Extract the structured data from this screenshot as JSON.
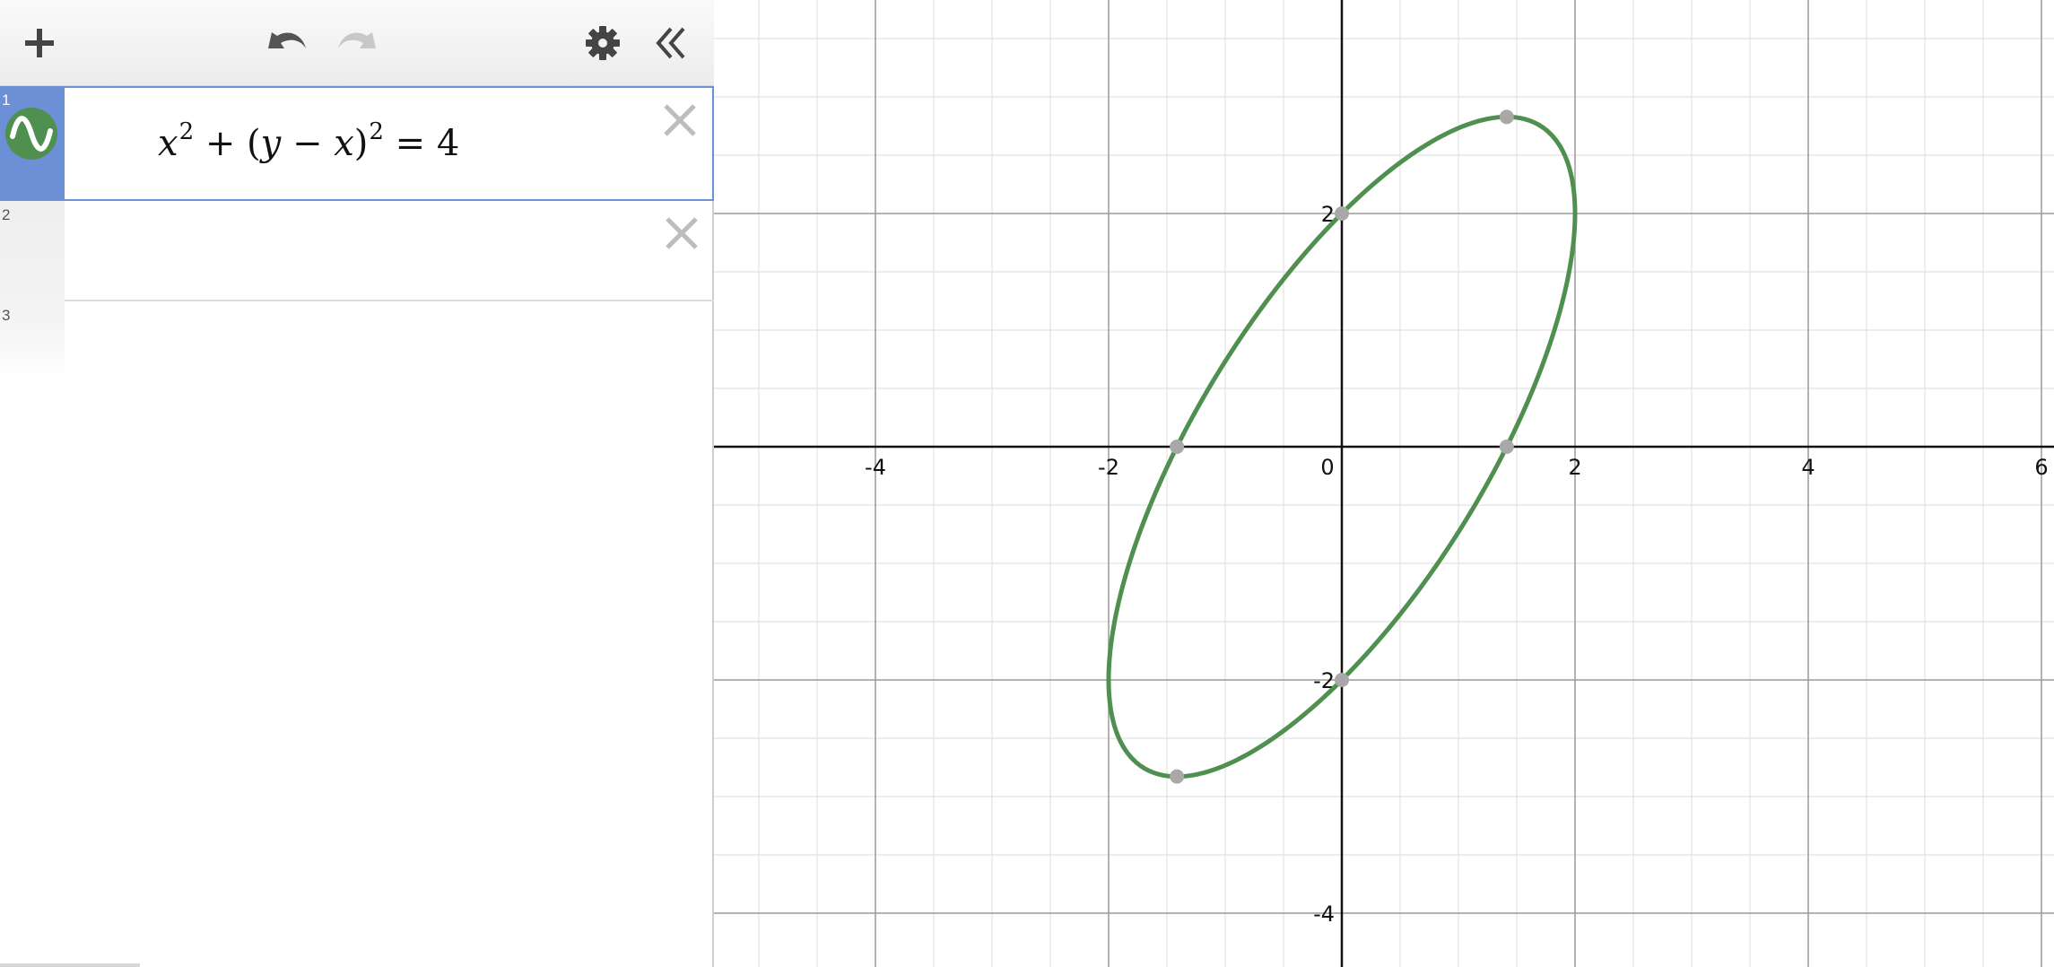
{
  "app": {
    "toolbar": {
      "add_icon": "plus-icon",
      "undo_icon": "undo-icon",
      "redo_icon": "redo-icon",
      "settings_icon": "gear-icon",
      "collapse_icon": "double-chevron-left-icon"
    }
  },
  "expressions": [
    {
      "number": "1",
      "latex_parts": {
        "x": "x",
        "exp1": "2",
        "plus": " + (",
        "y": "y",
        "minus": " − ",
        "x2": "x",
        "close": ")",
        "exp2": "2",
        "eq": " = 4"
      },
      "color": "#4f8f4f",
      "visible": true
    },
    {
      "number": "2",
      "text": ""
    },
    {
      "number": "3",
      "text": ""
    }
  ],
  "graph": {
    "x_range": [
      -5.4,
      6.1
    ],
    "y_range": [
      -4.5,
      3.8
    ],
    "x_tick_labels": [
      "-4",
      "-2",
      "0",
      "2",
      "4",
      "6"
    ],
    "y_tick_labels": [
      "2",
      "-2",
      "-4"
    ],
    "major_step": 2,
    "minor_step": 0.5,
    "grid": true,
    "curve": {
      "equation": "x^2 + (y - x)^2 = 4",
      "color": "#4f8f4f",
      "points_of_interest": [
        {
          "x": 0,
          "y": 2
        },
        {
          "x": 0,
          "y": -2
        },
        {
          "x": -1.414,
          "y": 0
        },
        {
          "x": 1.414,
          "y": 0
        },
        {
          "x": 1.414,
          "y": 2.828
        },
        {
          "x": -1.414,
          "y": -2.828
        }
      ],
      "point_color": "#a8a8a8"
    }
  }
}
